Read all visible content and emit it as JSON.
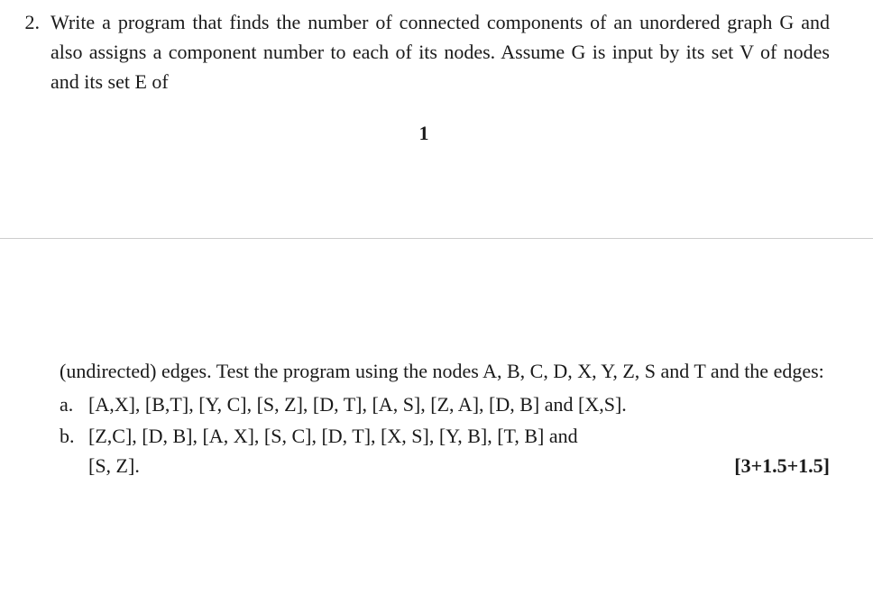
{
  "question": {
    "number": "2.",
    "text_part1": "Write a program that finds the number of connected components of an unordered graph G and also assigns a component number to each of its nodes. Assume G is input by its set V of nodes and its set E of",
    "text_part2": "(undirected) edges. Test the program using the nodes A, B, C, D, X, Y, Z, S and T and the edges:"
  },
  "page_number": "1",
  "subitems": {
    "a": {
      "label": "a.",
      "content": "[A,X], [B,T], [Y, C], [S, Z], [D, T], [A, S], [Z, A], [D, B] and [X,S]."
    },
    "b": {
      "label": "b.",
      "content_left": "[Z,C], [D, B], [A, X], [S, C], [D, T], [X, S], [Y, B], [T, B] and",
      "content_second_line": "[S, Z].",
      "marks": "[3+1.5+1.5]"
    }
  }
}
